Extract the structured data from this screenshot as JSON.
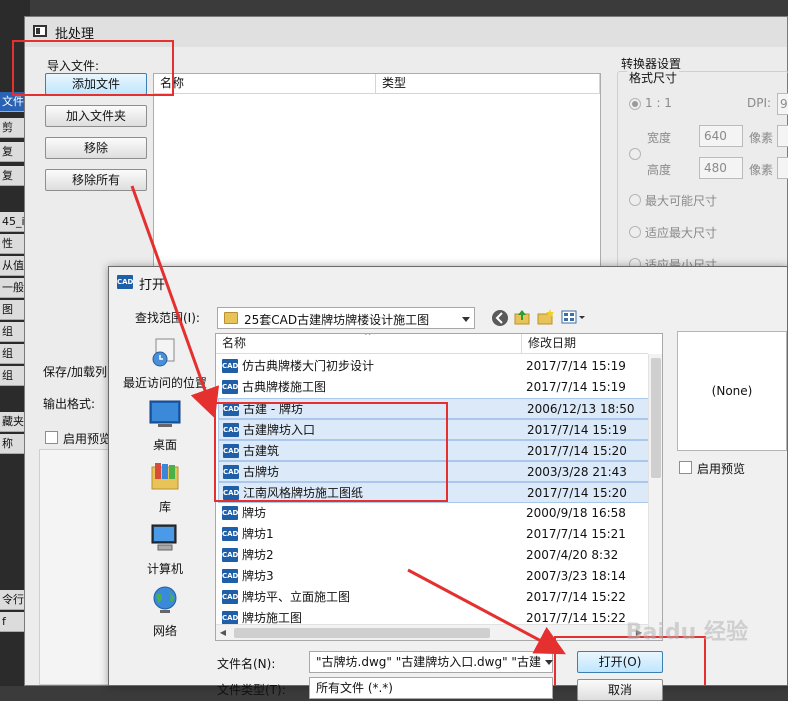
{
  "background_app": {
    "rows": [
      "文件",
      "剪",
      "复",
      "复",
      "45_i",
      "性",
      "从值",
      "一般",
      "图",
      "组",
      "组",
      "组",
      "藏夹",
      "称",
      "令行",
      "f"
    ]
  },
  "batch_dialog": {
    "title": "批处理",
    "import_label": "导入文件:",
    "buttons": {
      "add_file": "添加文件",
      "add_folder": "加入文件夹",
      "remove": "移除",
      "remove_all": "移除所有"
    },
    "list_columns": [
      "名称",
      "类型"
    ],
    "save_load_label": "保存/加载列",
    "output_format_label": "输出格式:",
    "enable_preview": "启用预览",
    "converter_settings": {
      "title": "转换器设置",
      "format_size": "格式尺寸",
      "ratio": "1 : 1",
      "dpi_label": "DPI:",
      "dpi_value": "9",
      "width_label": "宽度",
      "width_value": "640",
      "height_label": "高度",
      "height_value": "480",
      "pixel_label": "像素",
      "options": [
        "最大可能尺寸",
        "适应最大尺寸",
        "适应最小尺寸"
      ]
    }
  },
  "open_dialog": {
    "title": "打开",
    "app_icon_text": "CAD",
    "look_in_label": "查找范围(I):",
    "look_in_value": "25套CAD古建牌坊牌楼设计施工图",
    "places": [
      "最近访问的位置",
      "桌面",
      "库",
      "计算机",
      "网络"
    ],
    "columns": {
      "name": "名称",
      "date": "修改日期"
    },
    "files": [
      {
        "name": "仿古典牌楼大门初步设计",
        "date": "2017/7/14 15:19",
        "selected": false
      },
      {
        "name": "古典牌楼施工图",
        "date": "2017/7/14 15:19",
        "selected": false
      },
      {
        "name": "古建 - 牌坊",
        "date": "2006/12/13 18:50",
        "selected": true
      },
      {
        "name": "古建牌坊入口",
        "date": "2017/7/14 15:19",
        "selected": true
      },
      {
        "name": "古建筑",
        "date": "2017/7/14 15:20",
        "selected": true
      },
      {
        "name": "古牌坊",
        "date": "2003/3/28 21:43",
        "selected": true
      },
      {
        "name": "江南风格牌坊施工图纸",
        "date": "2017/7/14 15:20",
        "selected": true
      },
      {
        "name": "牌坊",
        "date": "2000/9/18 16:58",
        "selected": false
      },
      {
        "name": "牌坊1",
        "date": "2017/7/14 15:21",
        "selected": false
      },
      {
        "name": "牌坊2",
        "date": "2007/4/20 8:32",
        "selected": false
      },
      {
        "name": "牌坊3",
        "date": "2007/3/23 18:14",
        "selected": false
      },
      {
        "name": "牌坊平、立面施工图",
        "date": "2017/7/14 15:22",
        "selected": false
      },
      {
        "name": "牌坊施工图",
        "date": "2017/7/14 15:22",
        "selected": false
      }
    ],
    "preview_text": "(None)",
    "enable_preview": "启用预览",
    "filename_label": "文件名(N):",
    "filename_value": "\"古牌坊.dwg\" \"古建牌坊入口.dwg\" \"古建",
    "filetype_label": "文件类型(T):",
    "filetype_value": "所有文件 (*.*)",
    "open_button": "打开(O)",
    "cancel_button": "取消"
  },
  "watermark": "Baidu 经验",
  "colors": {
    "annotation": "#e53030",
    "selection": "#dbe9f8",
    "cad_icon": "#1f5fa8"
  }
}
